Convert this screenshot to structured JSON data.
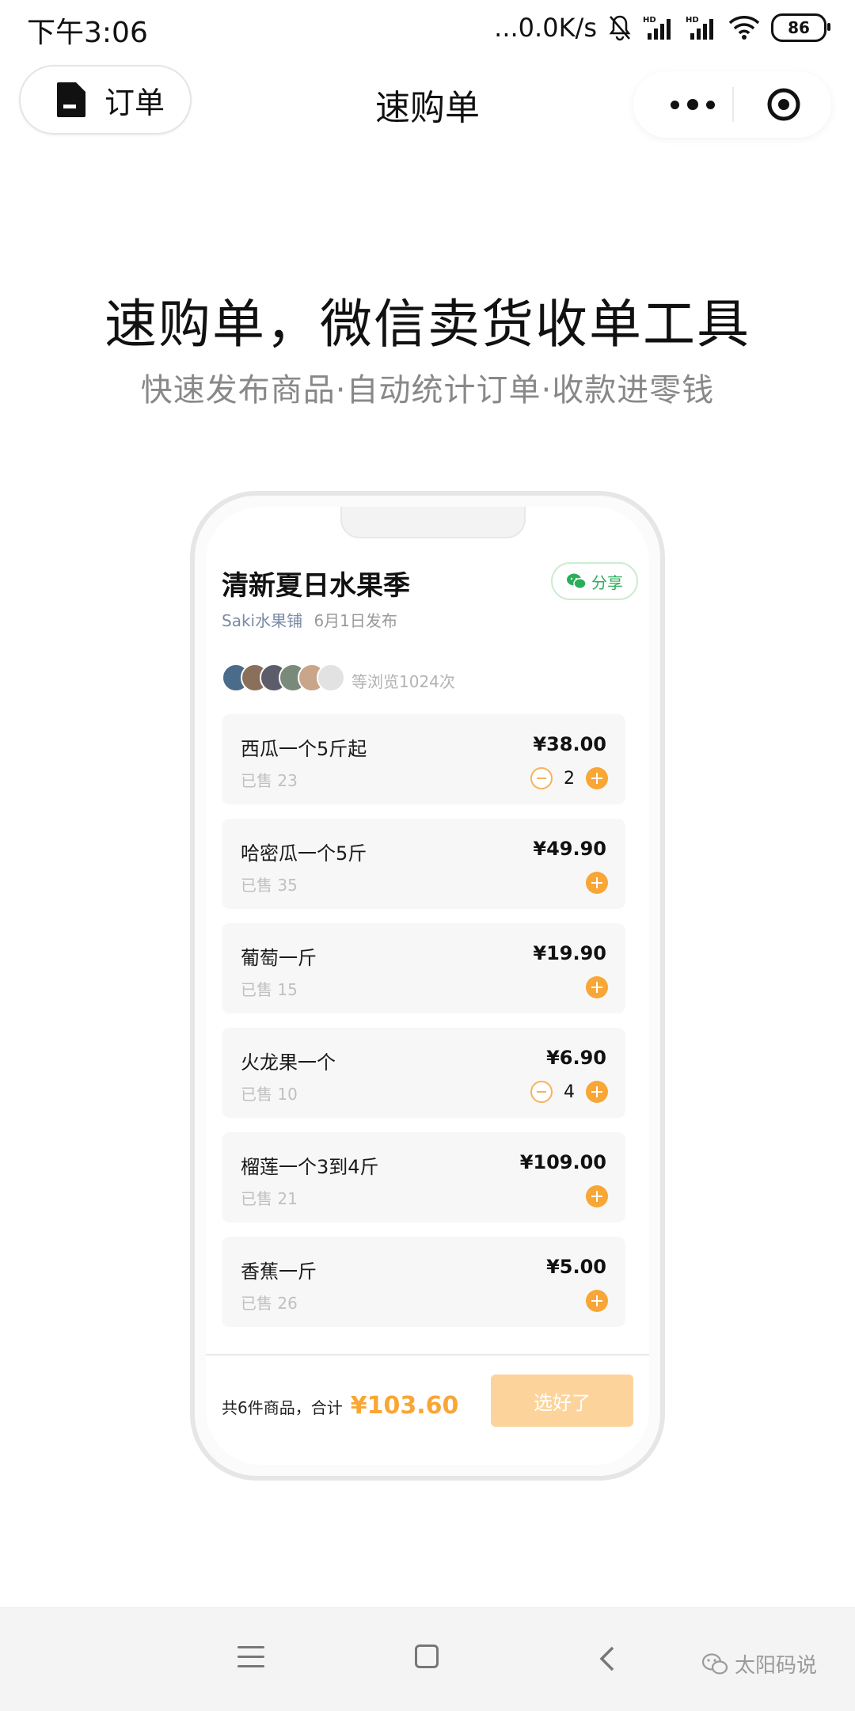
{
  "status_bar": {
    "time": "下午3:06",
    "net_speed": "...0.0K/s",
    "battery": "86",
    "icons": [
      "alarm-muted-icon",
      "signal-hd-icon",
      "signal-hd-icon",
      "wifi-icon",
      "battery-icon"
    ]
  },
  "navbar": {
    "orders_label": "订单",
    "title": "速购单",
    "menu_icon": "more-dots-icon",
    "close_icon": "target-icon"
  },
  "hero": {
    "title": "速购单，微信卖货收单工具",
    "subtitle": "快速发布商品·自动统计订单·收款进零钱"
  },
  "mockup": {
    "shop_title": "清新夏日水果季",
    "shop_name": "Saki水果铺",
    "publish_date": "6月1日发布",
    "share_label": "分享",
    "views_text": "等浏览1024次",
    "avatar_colors": [
      "#4a6b8a",
      "#8a6f5a",
      "#5c5c6b",
      "#7a8a7a",
      "#c9a58a",
      "#e2e2e2"
    ],
    "items": [
      {
        "name": "西瓜一个5斤起",
        "sold": "已售 23",
        "price": "¥38.00",
        "qty": "2"
      },
      {
        "name": "哈密瓜一个5斤",
        "sold": "已售 35",
        "price": "¥49.90",
        "qty": ""
      },
      {
        "name": "葡萄一斤",
        "sold": "已售 15",
        "price": "¥19.90",
        "qty": ""
      },
      {
        "name": "火龙果一个",
        "sold": "已售 10",
        "price": "¥6.90",
        "qty": "4"
      },
      {
        "name": "榴莲一个3到4斤",
        "sold": "已售 21",
        "price": "¥109.00",
        "qty": ""
      },
      {
        "name": "香蕉一斤",
        "sold": "已售 26",
        "price": "¥5.00",
        "qty": ""
      }
    ],
    "cart_summary": "共6件商品，合计",
    "cart_total": "¥103.60",
    "checkout_label": "选好了"
  },
  "system_nav": {
    "watermark": "太阳码说"
  },
  "colors": {
    "accent": "#f8a635",
    "share_green": "#2aae5a"
  }
}
